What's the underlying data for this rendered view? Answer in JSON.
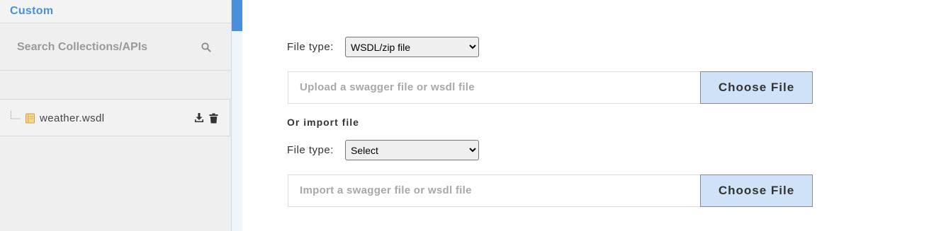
{
  "sidebar": {
    "title": "Custom",
    "search": {
      "placeholder": "Search Collections/APIs"
    },
    "tree": [
      {
        "label": "weather.wsdl"
      }
    ]
  },
  "main": {
    "upload": {
      "file_type_label": "File type:",
      "file_type_selected": "WSDL/zip file",
      "placeholder": "Upload a swagger file or wsdl file",
      "button_label": "Choose File"
    },
    "import": {
      "heading": "Or import file",
      "file_type_label": "File type:",
      "file_type_selected": "Select",
      "placeholder": "Import a swagger file or wsdl file",
      "button_label": "Choose File"
    }
  },
  "colors": {
    "accent": "#4a8fdc",
    "button_bg": "#cfe2f8",
    "sidebar_bg": "#efefef"
  }
}
